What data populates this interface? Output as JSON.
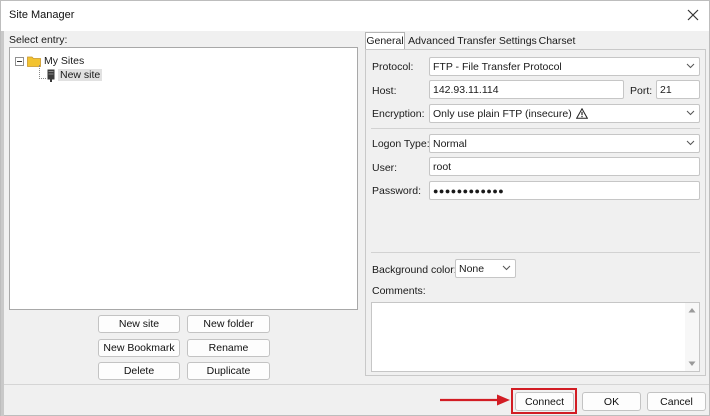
{
  "window": {
    "title": "Site Manager"
  },
  "left": {
    "select_entry_label": "Select entry:",
    "tree": {
      "root_label": "My Sites",
      "child_label": "New site"
    },
    "buttons": {
      "new_site": "New site",
      "new_folder": "New folder",
      "new_bookmark": "New Bookmark",
      "rename": "Rename",
      "delete": "Delete",
      "duplicate": "Duplicate"
    }
  },
  "tabs": [
    {
      "label": "General",
      "active": true
    },
    {
      "label": "Advanced",
      "active": false
    },
    {
      "label": "Transfer Settings",
      "active": false
    },
    {
      "label": "Charset",
      "active": false
    }
  ],
  "general": {
    "protocol_label": "Protocol:",
    "protocol_value": "FTP - File Transfer Protocol",
    "host_label": "Host:",
    "host_value": "142.93.11.114",
    "port_label": "Port:",
    "port_value": "21",
    "encryption_label": "Encryption:",
    "encryption_value": "Only use plain FTP (insecure)",
    "logon_type_label": "Logon Type:",
    "logon_type_value": "Normal",
    "user_label": "User:",
    "user_value": "root",
    "password_label": "Password:",
    "password_value": "●●●●●●●●●●●●",
    "background_color_label": "Background color:",
    "background_color_value": "None",
    "comments_label": "Comments:"
  },
  "footer": {
    "connect": "Connect",
    "ok": "OK",
    "cancel": "Cancel"
  },
  "colors": {
    "highlight": "#d21d24",
    "folder": "#f2c331"
  },
  "icons": {
    "close": "close-icon",
    "folder": "folder-icon",
    "site": "server-icon",
    "warning": "warning-icon",
    "chevron": "chevron-down-icon"
  }
}
